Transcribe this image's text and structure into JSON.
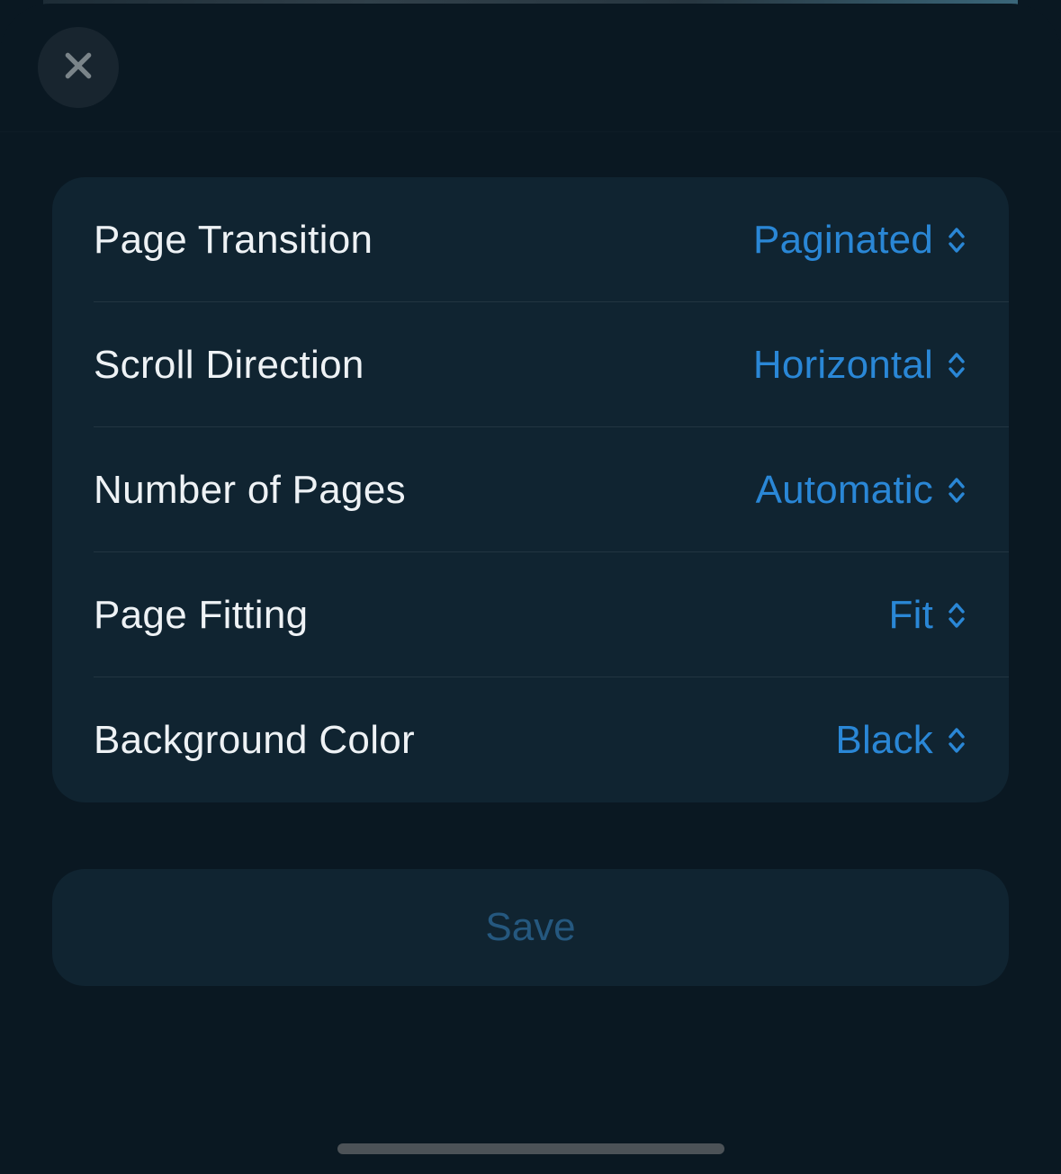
{
  "colors": {
    "accent": "#2a87d6",
    "sheet_bg": "#0a1822",
    "card_bg": "#102431"
  },
  "settings": {
    "rows": [
      {
        "label": "Page Transition",
        "value": "Paginated"
      },
      {
        "label": "Scroll Direction",
        "value": "Horizontal"
      },
      {
        "label": "Number of Pages",
        "value": "Automatic"
      },
      {
        "label": "Page Fitting",
        "value": "Fit"
      },
      {
        "label": "Background Color",
        "value": "Black"
      }
    ]
  },
  "buttons": {
    "save": "Save"
  }
}
